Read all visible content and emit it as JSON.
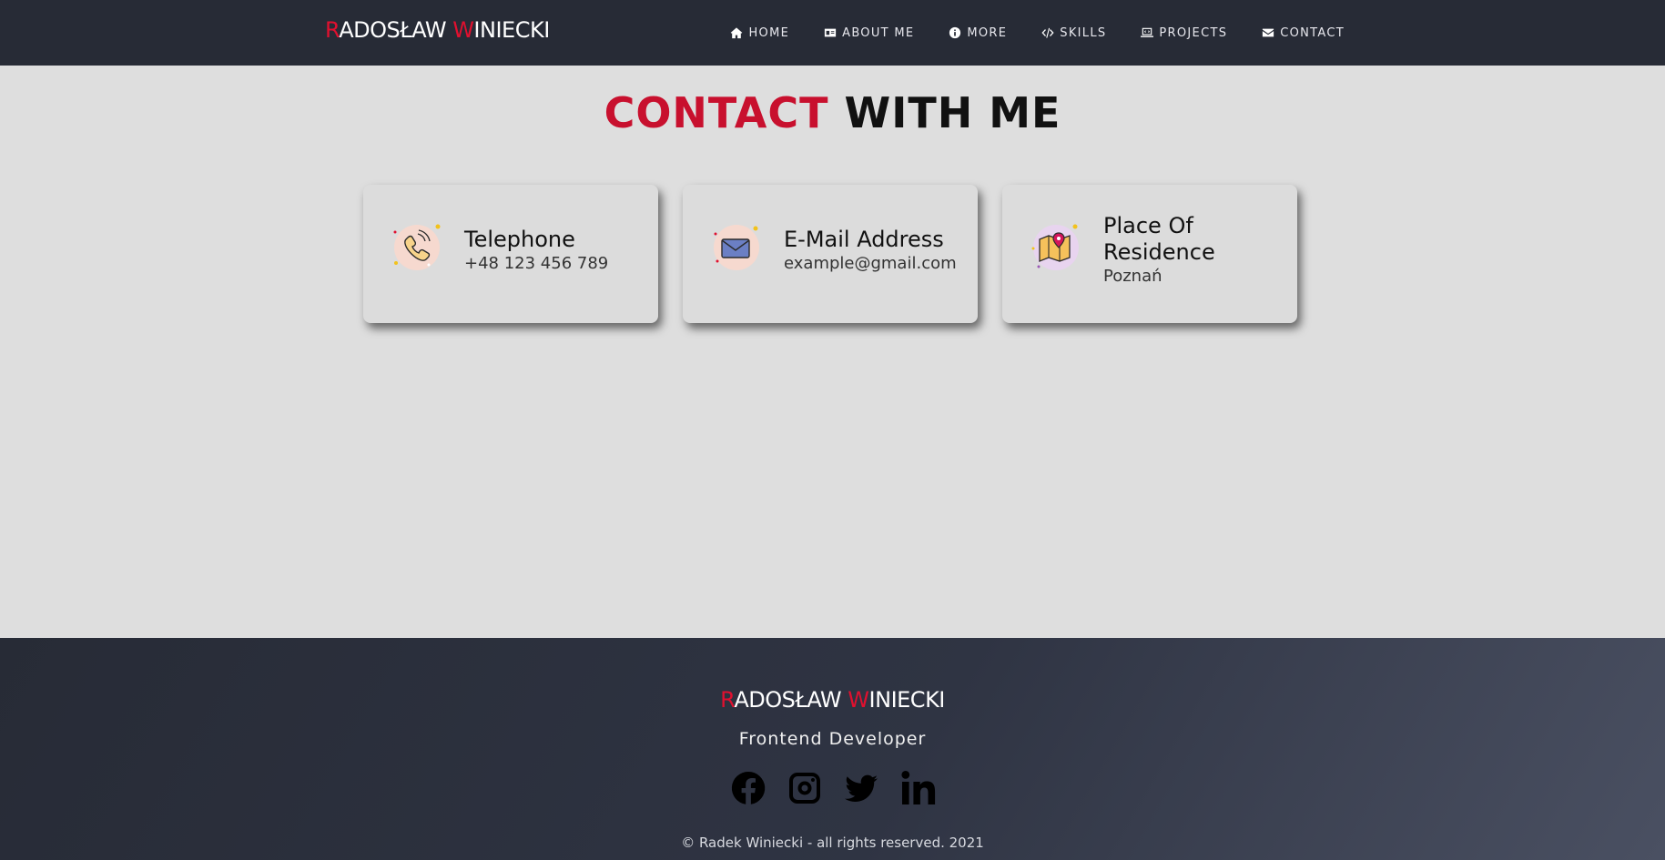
{
  "header": {
    "brand": {
      "first_initial": "R",
      "first_rest": "ADOSŁAW ",
      "last_initial": "W",
      "last_rest": "INIECKI"
    },
    "nav": [
      {
        "label": "HOME",
        "icon": "home-icon"
      },
      {
        "label": "ABOUT ME",
        "icon": "id-card-icon"
      },
      {
        "label": "MORE",
        "icon": "info-circle-icon"
      },
      {
        "label": "SKILLS",
        "icon": "code-icon"
      },
      {
        "label": "PROJECTS",
        "icon": "laptop-code-icon"
      },
      {
        "label": "CONTACT",
        "icon": "envelope-icon"
      }
    ]
  },
  "main": {
    "title_accent": "CONTACT",
    "title_rest": " WITH ME",
    "cards": [
      {
        "title": "Telephone",
        "value": "+48 123 456 789",
        "icon": "telephone-icon"
      },
      {
        "title": "E-Mail Address",
        "value": "example@gmail.com",
        "icon": "mail-icon"
      },
      {
        "title": "Place Of Residence",
        "value": "Poznań",
        "icon": "map-pin-icon"
      }
    ]
  },
  "footer": {
    "brand": {
      "first_initial": "R",
      "first_rest": "ADOSŁAW ",
      "last_initial": "W",
      "last_rest": "INIECKI"
    },
    "subtitle": "Frontend Developer",
    "socials": [
      {
        "name": "facebook-icon"
      },
      {
        "name": "instagram-icon"
      },
      {
        "name": "twitter-icon"
      },
      {
        "name": "linkedin-icon"
      }
    ],
    "copyright": "© Radek Winiecki - all rights reserved. 2021"
  },
  "colors": {
    "accent": "#c8102e",
    "nav_bg": "#272b36",
    "page_bg": "#dedede"
  }
}
